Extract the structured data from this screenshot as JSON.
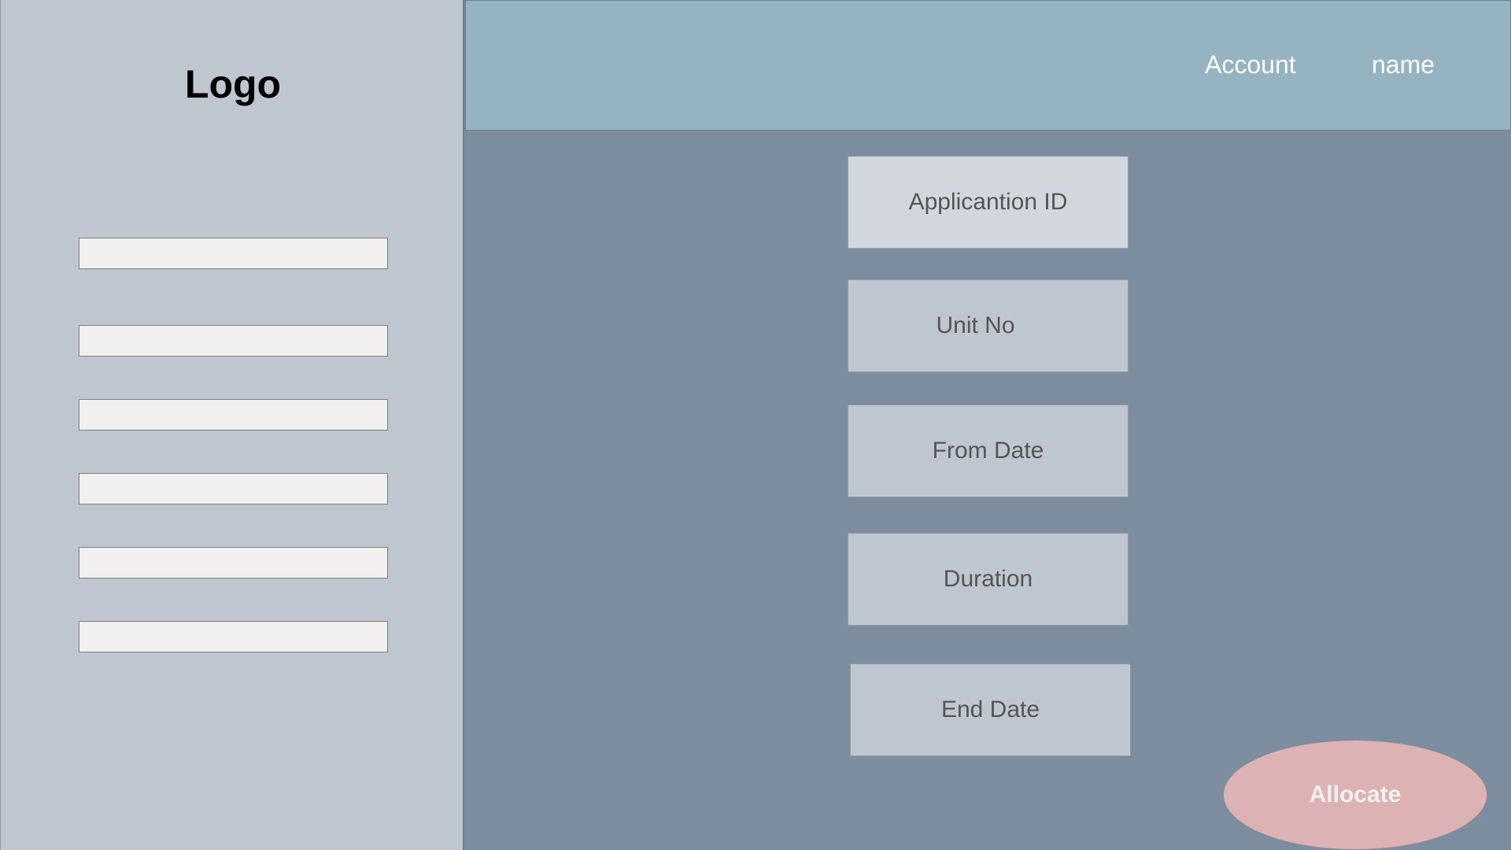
{
  "sidebar": {
    "logo": "Logo",
    "items": [
      "",
      "",
      "",
      "",
      "",
      ""
    ]
  },
  "header": {
    "account_label": "Account",
    "name_label": "name"
  },
  "form": {
    "fields": [
      {
        "label": "Applicantion ID"
      },
      {
        "label": "Unit No"
      },
      {
        "label": "From Date"
      },
      {
        "label": "Duration"
      },
      {
        "label": "End Date"
      }
    ]
  },
  "actions": {
    "allocate_label": "Allocate"
  },
  "colors": {
    "sidebar_bg": "#bec6cf",
    "header_bg": "#96b3c1",
    "main_bg": "#7b8d9f",
    "field_bg": "#bec6cf",
    "active_field_bg": "#d1d7dc",
    "nav_item_bg": "#f1f0ef",
    "allocate_bg": "#dcb2b4"
  }
}
